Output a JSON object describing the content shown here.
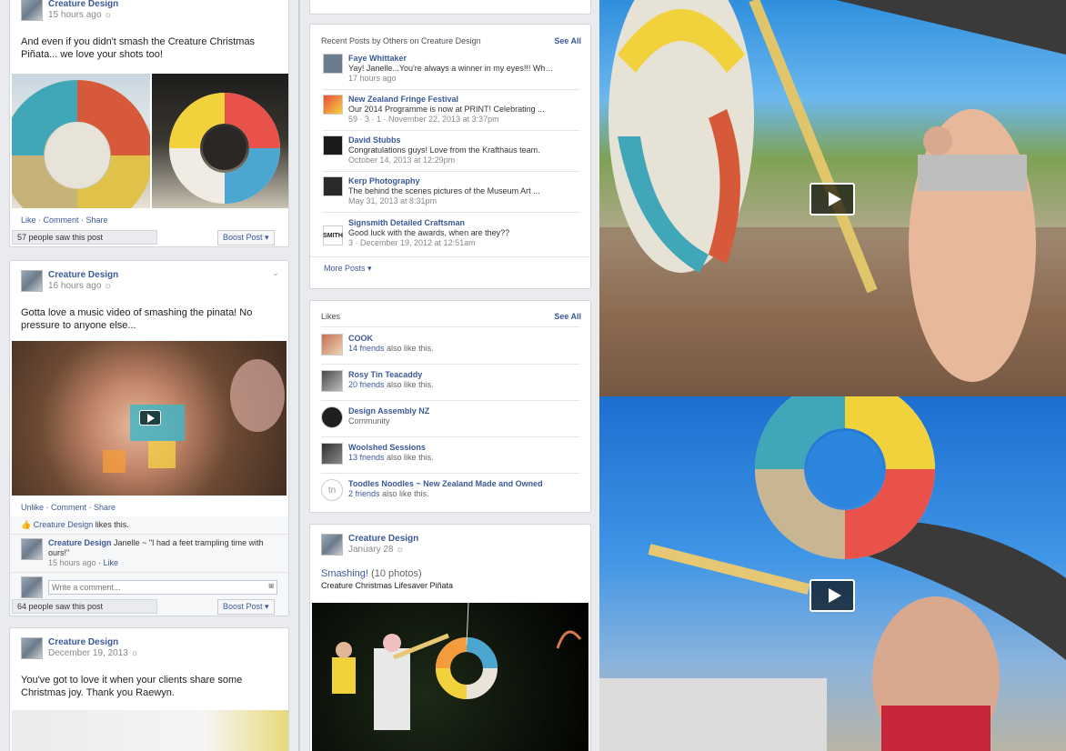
{
  "posts": [
    {
      "author": "Creature Design",
      "time": "15 hours ago",
      "text": "And even if you didn't smash the Creature Christmas Piñata... we love your shots too!",
      "actions": [
        "Like",
        "Comment",
        "Share"
      ],
      "saw": "57 people saw this post",
      "boost": "Boost Post"
    },
    {
      "author": "Creature Design",
      "time": "16 hours ago",
      "text": "Gotta love a music video of smashing the pinata! No pressure to anyone else...",
      "actions": [
        "Unlike",
        "Comment",
        "Share"
      ],
      "likes_line": {
        "name": "Creature Design",
        "suffix": "likes this."
      },
      "comment": {
        "author": "Creature Design",
        "text": "Janelle ~ \"I had a feet trampling time with ours!\"",
        "time": "15 hours ago",
        "like": "Like"
      },
      "comment_placeholder": "Write a comment...",
      "saw": "64 people saw this post",
      "boost": "Boost Post"
    },
    {
      "author": "Creature Design",
      "time": "December 19, 2013",
      "text": "You've got to love it when your clients share some Christmas joy. Thank you Raewyn."
    }
  ],
  "recent_posts": {
    "title": "Recent Posts by Others on Creature Design",
    "see_all": "See All",
    "items": [
      {
        "name": "Faye Whittaker",
        "msg": "Yay! Janelle...You're always a winner in my eyes!!! Wha...",
        "time": "17 hours ago"
      },
      {
        "name": "New Zealand Fringe Festival",
        "msg": "Our 2014 Programme is now at PRINT! Celebrating ...",
        "time": "59 · 3 · 1 · November 22, 2013 at 3:37pm"
      },
      {
        "name": "David Stubbs",
        "msg": "Congratulations guys! Love from the Krafthaus team.",
        "time": "October 14, 2013 at 12:29pm"
      },
      {
        "name": "Kerp Photography",
        "msg": "The behind the scenes pictures of the Museum Art ...",
        "time": "May 31, 2013 at 8:31pm"
      },
      {
        "name": "Signsmith Detailed Craftsman",
        "msg": "Good luck with the awards, when are they??",
        "time": "3 · December 19, 2012 at 12:51am"
      }
    ],
    "more": "More Posts"
  },
  "likes": {
    "title": "Likes",
    "see_all": "See All",
    "items": [
      {
        "name": "COOK",
        "sub_link": "14 friends",
        "sub": "also like this."
      },
      {
        "name": "Rosy Tin Teacaddy",
        "sub_link": "20 friends",
        "sub": "also like this."
      },
      {
        "name": "Design Assembly NZ",
        "sub_link": "",
        "sub": "Community"
      },
      {
        "name": "Woolshed Sessions",
        "sub_link": "13 friends",
        "sub": "also like this."
      },
      {
        "name": "Toodles Noodles ~ New Zealand Made and Owned",
        "sub_link": "2 friends",
        "sub": "also like this."
      }
    ]
  },
  "album_post": {
    "author": "Creature Design",
    "time": "January 28",
    "title": "Smashing!",
    "count": "(10 photos)",
    "subtitle": "Creature Christmas Lifesaver Piñata"
  }
}
